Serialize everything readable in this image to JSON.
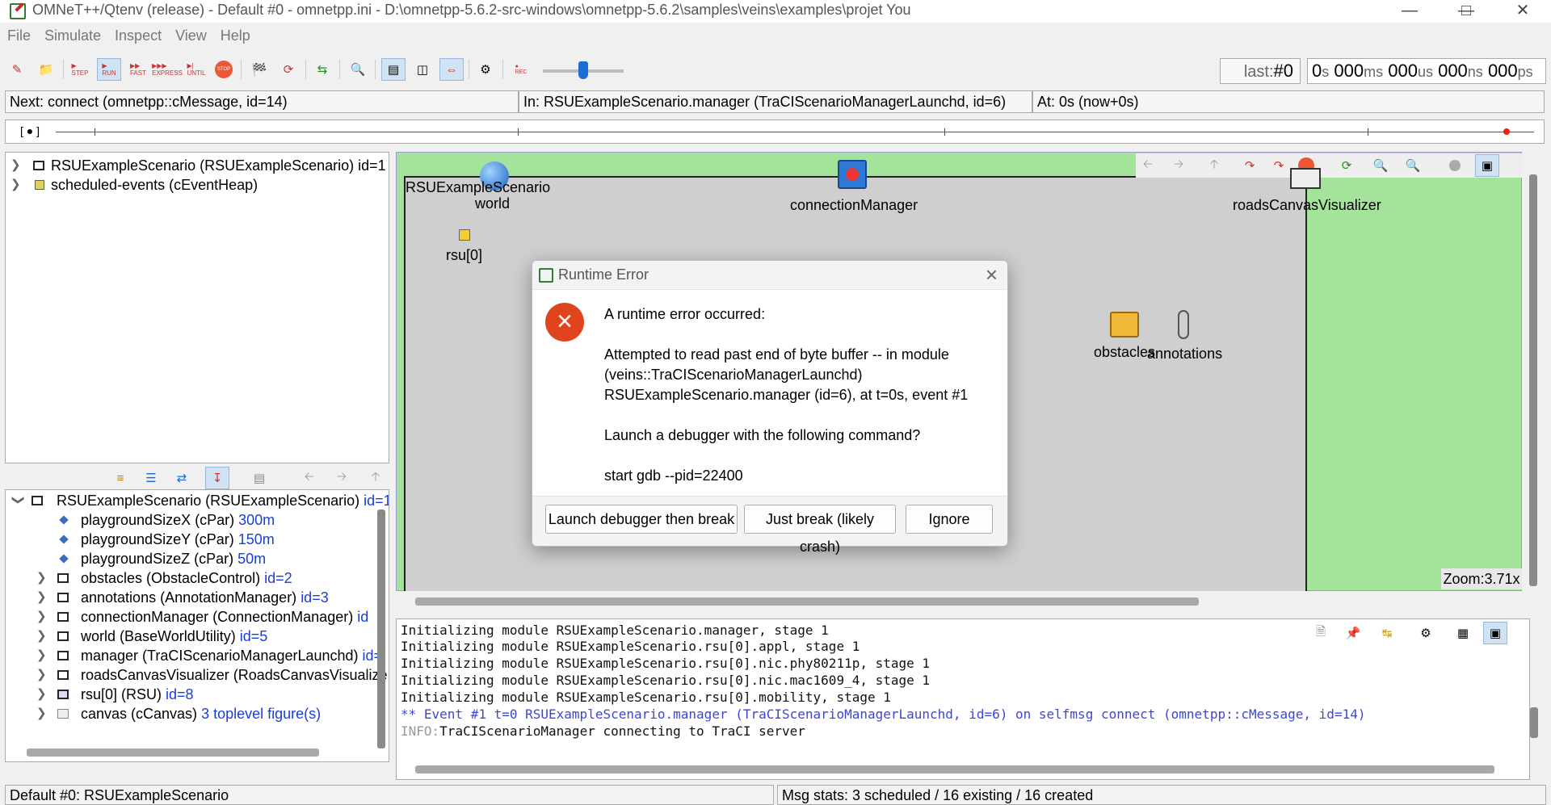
{
  "window": {
    "title": "OMNeT++/Qtenv (release) - Default #0 - omnetpp.ini - D:\\omnetpp-5.6.2-src-windows\\omnetpp-5.6.2\\samples\\veins\\examples\\projet You"
  },
  "menu": [
    "File",
    "Simulate",
    "Inspect",
    "View",
    "Help"
  ],
  "toolbar": {
    "step_label": "STEP",
    "run_label": "RUN",
    "fast_label": "FAST",
    "express_label": "EXPRESS",
    "until_label": "UNTIL",
    "stop_label": "STOP",
    "rec_label": "REC"
  },
  "counters": {
    "last_label": "last:",
    "last_value": "#0",
    "time": {
      "s": "0",
      "ms": "000",
      "us": "000",
      "ns": "000",
      "ps": "000"
    },
    "units": {
      "s": "s",
      "ms": "ms",
      "us": "us",
      "ns": "ns",
      "ps": "ps"
    }
  },
  "info": {
    "next": "Next: connect (omnetpp::cMessage, id=14)",
    "in": "In: RSUExampleScenario.manager (TraCIScenarioManagerLaunchd, id=6)",
    "at": "At: 0s (now+0s)"
  },
  "timeline": {
    "marker": "[ ● ]"
  },
  "object_tree": [
    {
      "label": "RSUExampleScenario (RSUExampleScenario) id=1"
    },
    {
      "label": "scheduled-events (cEventHeap)"
    }
  ],
  "inspector_tree": [
    {
      "label": "RSUExampleScenario (RSUExampleScenario) ",
      "id": "id=1",
      "kind": "root"
    },
    {
      "label": "playgroundSizeX (cPar) ",
      "id": "300m",
      "kind": "par"
    },
    {
      "label": "playgroundSizeY (cPar) ",
      "id": "150m",
      "kind": "par"
    },
    {
      "label": "playgroundSizeZ (cPar) ",
      "id": "50m",
      "kind": "par"
    },
    {
      "label": "obstacles (ObstacleControl) ",
      "id": "id=2",
      "kind": "mod"
    },
    {
      "label": "annotations (AnnotationManager) ",
      "id": "id=3",
      "kind": "mod"
    },
    {
      "label": "connectionManager (ConnectionManager) ",
      "id": "id",
      "kind": "mod"
    },
    {
      "label": "world (BaseWorldUtility) ",
      "id": "id=5",
      "kind": "mod"
    },
    {
      "label": "manager (TraCIScenarioManagerLaunchd) ",
      "id": "id=",
      "kind": "mod"
    },
    {
      "label": "roadsCanvasVisualizer (RoadsCanvasVisualize",
      "id": "",
      "kind": "mod"
    },
    {
      "label": "rsu[0] (RSU) ",
      "id": "id=8",
      "kind": "compound"
    },
    {
      "label": "canvas (cCanvas) ",
      "id": "3 toplevel figure(s)",
      "kind": "canvas"
    }
  ],
  "network": {
    "scenario_label": "RSUExampleScenario",
    "nodes": {
      "world": "world",
      "connectionManager": "connectionManager",
      "roadsCanvasVisualizer": "roadsCanvasVisualizer",
      "rsu": "rsu[0]",
      "obstacles": "obstacles",
      "annotations": "annotations"
    },
    "zoom": "Zoom:3.71x"
  },
  "log": [
    {
      "text": "Initializing module RSUExampleScenario.manager, stage 1",
      "kind": "normal"
    },
    {
      "text": "Initializing module RSUExampleScenario.rsu[0].appl, stage 1",
      "kind": "normal"
    },
    {
      "text": "Initializing module RSUExampleScenario.rsu[0].nic.phy80211p, stage 1",
      "kind": "normal"
    },
    {
      "text": "Initializing module RSUExampleScenario.rsu[0].nic.mac1609_4, stage 1",
      "kind": "normal"
    },
    {
      "text": "Initializing module RSUExampleScenario.rsu[0].mobility, stage 1",
      "kind": "normal"
    },
    {
      "text": "** Event #1  t=0  RSUExampleScenario.manager (TraCIScenarioManagerLaunchd, id=6)  on selfmsg connect (omnetpp::cMessage, id=14)",
      "kind": "event"
    }
  ],
  "log_info": {
    "prefix": "INFO:",
    "text": "TraCIScenarioManager connecting to TraCI server"
  },
  "status": {
    "left": "Default #0: RSUExampleScenario",
    "right": "Msg stats: 3 scheduled / 16 existing / 16 created"
  },
  "dialog": {
    "title": "Runtime Error",
    "heading": "A runtime error occurred:",
    "message_lines": [
      "Attempted to read past end of byte buffer -- in module",
      "(veins::TraCIScenarioManagerLaunchd)",
      "RSUExampleScenario.manager (id=6), at t=0s, event #1"
    ],
    "question": "Launch a debugger with the following command?",
    "command": "start gdb --pid=22400",
    "buttons": {
      "launch": "Launch debugger then break",
      "just_break": "Just break (likely crash)",
      "ignore": "Ignore"
    }
  },
  "colors": {
    "canvas_bg": "#a3e39a",
    "playground_bg": "#cfcfcf",
    "id_blue": "#1a3ed6",
    "error_red": "#e0441c",
    "event_blue": "#3b46d6"
  }
}
